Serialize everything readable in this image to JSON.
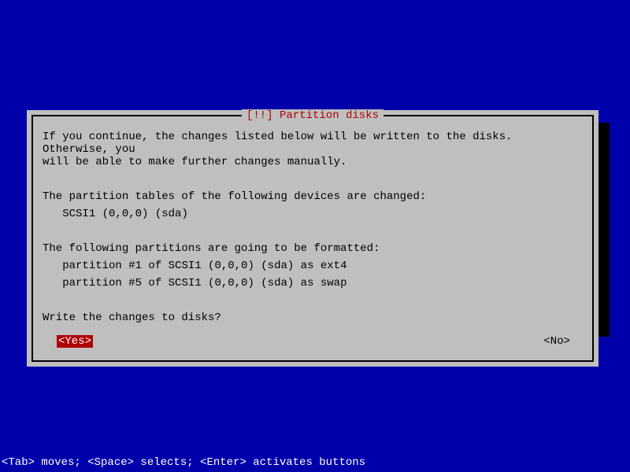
{
  "dialog": {
    "title": "[!!] Partition disks",
    "intro": "If you continue, the changes listed below will be written to the disks. Otherwise, you\nwill be able to make further changes manually.",
    "tables_header": "The partition tables of the following devices are changed:",
    "tables_devices": [
      "SCSI1 (0,0,0) (sda)"
    ],
    "format_header": "The following partitions are going to be formatted:",
    "format_partitions": [
      "partition #1 of SCSI1 (0,0,0) (sda) as ext4",
      "partition #5 of SCSI1 (0,0,0) (sda) as swap"
    ],
    "question": "Write the changes to disks?",
    "yes_label": "<Yes>",
    "no_label": "<No>"
  },
  "helpbar": "<Tab> moves; <Space> selects; <Enter> activates buttons"
}
